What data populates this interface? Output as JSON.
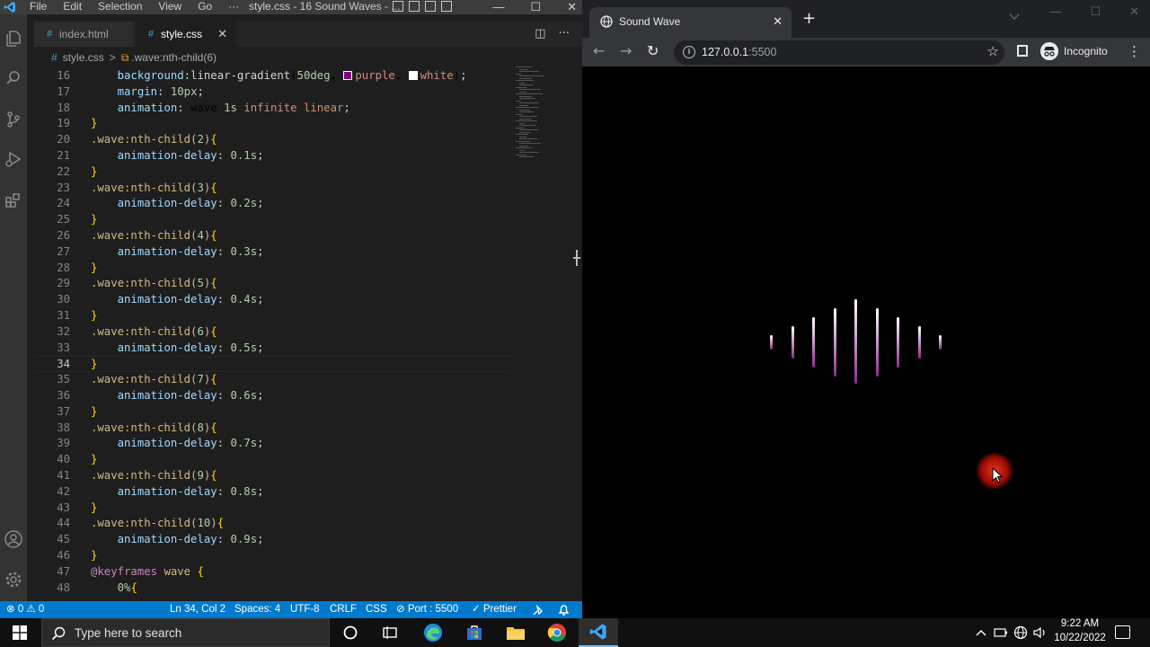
{
  "vscode": {
    "menu": [
      "File",
      "Edit",
      "Selection",
      "View",
      "Go",
      "···"
    ],
    "window_title": "style.css - 16 Sound Waves - ...",
    "window_buttons": [
      "—",
      "☐",
      "✕"
    ],
    "tabs": [
      {
        "label": "index.html",
        "icon": "#"
      },
      {
        "label": "style.css",
        "icon": "#",
        "close": "✕"
      }
    ],
    "tab_actions": [
      "◫",
      "···"
    ],
    "breadcrumb": {
      "file": "style.css",
      "separator": ">",
      "symbol": ".wave:nth-child(6)"
    },
    "code_lines": [
      {
        "n": "16",
        "t": "    background:linear-gradient(50deg, purple, white);"
      },
      {
        "n": "17",
        "t": "    margin: 10px;"
      },
      {
        "n": "18",
        "t": "    animation: wave 1s infinite linear;"
      },
      {
        "n": "19",
        "t": "}"
      },
      {
        "n": "20",
        "t": ".wave:nth-child(2){"
      },
      {
        "n": "21",
        "t": "    animation-delay: 0.1s;"
      },
      {
        "n": "22",
        "t": "}"
      },
      {
        "n": "23",
        "t": ".wave:nth-child(3){"
      },
      {
        "n": "24",
        "t": "    animation-delay: 0.2s;"
      },
      {
        "n": "25",
        "t": "}"
      },
      {
        "n": "26",
        "t": ".wave:nth-child(4){"
      },
      {
        "n": "27",
        "t": "    animation-delay: 0.3s;"
      },
      {
        "n": "28",
        "t": "}"
      },
      {
        "n": "29",
        "t": ".wave:nth-child(5){"
      },
      {
        "n": "30",
        "t": "    animation-delay: 0.4s;"
      },
      {
        "n": "31",
        "t": "}"
      },
      {
        "n": "32",
        "t": ".wave:nth-child(6){"
      },
      {
        "n": "33",
        "t": "    animation-delay: 0.5s;"
      },
      {
        "n": "34",
        "t": "}"
      },
      {
        "n": "35",
        "t": ".wave:nth-child(7){"
      },
      {
        "n": "36",
        "t": "    animation-delay: 0.6s;"
      },
      {
        "n": "37",
        "t": "}"
      },
      {
        "n": "38",
        "t": ".wave:nth-child(8){"
      },
      {
        "n": "39",
        "t": "    animation-delay: 0.7s;"
      },
      {
        "n": "40",
        "t": "}"
      },
      {
        "n": "41",
        "t": ".wave:nth-child(9){"
      },
      {
        "n": "42",
        "t": "    animation-delay: 0.8s;"
      },
      {
        "n": "43",
        "t": "}"
      },
      {
        "n": "44",
        "t": ".wave:nth-child(10){"
      },
      {
        "n": "45",
        "t": "    animation-delay: 0.9s;"
      },
      {
        "n": "46",
        "t": "}"
      },
      {
        "n": "47",
        "t": "@keyframes wave {"
      },
      {
        "n": "48",
        "t": "    0%{"
      }
    ],
    "current_line": "34",
    "status": {
      "problems": "⊗ 0 ⚠ 0",
      "position": "Ln 34, Col 2",
      "spaces": "Spaces: 4",
      "encoding": "UTF-8",
      "eol": "CRLF",
      "language": "CSS",
      "port": "⊘ Port : 5500",
      "prettier": "✓ Prettier"
    }
  },
  "chrome": {
    "tab_title": "Sound Wave",
    "tab_close": "✕",
    "new_tab": "+",
    "url_host": "127.0.0.1",
    "url_port": ":5500",
    "profile_label": "Incognito",
    "window_buttons": [
      "—",
      "☐",
      "✕"
    ],
    "nav": {
      "back": "←",
      "forward": "→",
      "reload": "↻"
    },
    "page": {
      "wave_colors": {
        "top": "#ffffff",
        "bottom": "#8e2a8c"
      }
    }
  },
  "taskbar": {
    "search_placeholder": "Type here to search",
    "time": "9:22 AM",
    "date": "10/22/2022",
    "tray_icons": [
      "chevron-up-icon",
      "battery-icon",
      "network-icon",
      "volume-icon"
    ]
  }
}
